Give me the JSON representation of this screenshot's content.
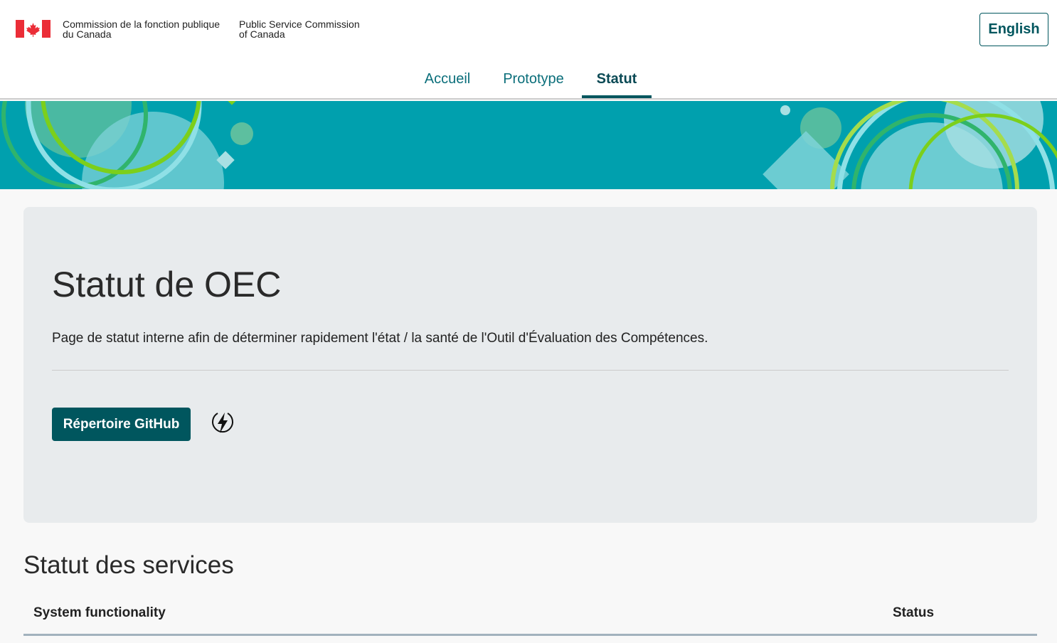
{
  "header": {
    "org_fr_line1": "Commission de la fonction publique",
    "org_fr_line2": "du Canada",
    "org_en_line1": "Public Service Commission",
    "org_en_line2": "of Canada",
    "language_toggle": "English",
    "flag_icon": "canada-flag-icon"
  },
  "nav": {
    "items": [
      {
        "label": "Accueil",
        "active": false
      },
      {
        "label": "Prototype",
        "active": false
      },
      {
        "label": "Statut",
        "active": true
      }
    ]
  },
  "main": {
    "title": "Statut de OEC",
    "description": "Page de statut interne afin de déterminer rapidement l'état / la santé de l'Outil d'Évaluation des Compétences.",
    "github_button": "Répertoire GitHub",
    "bolt_icon": "lightning-bolt-icon"
  },
  "services": {
    "title": "Statut des services",
    "columns": [
      "System functionality",
      "Status"
    ]
  },
  "colors": {
    "primary": "#00565e",
    "banner": "#00a0ae",
    "flag_red": "#eb2d37"
  }
}
